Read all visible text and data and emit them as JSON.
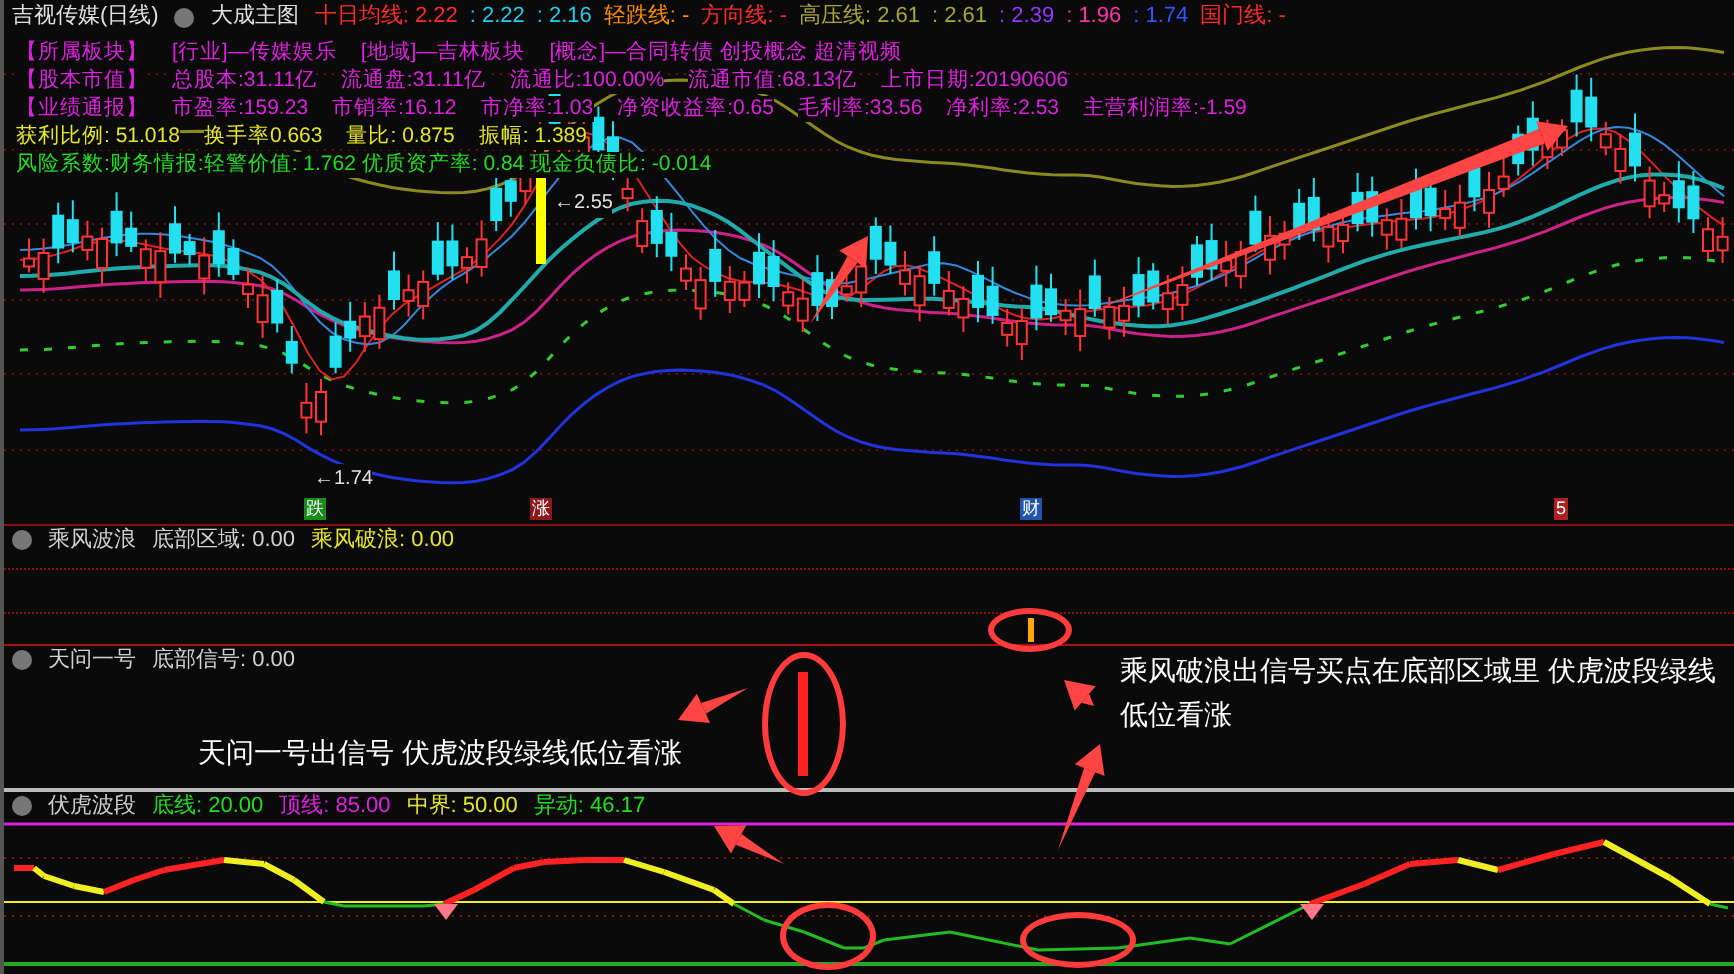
{
  "header": {
    "title": "吉视传媒(日线)",
    "indicator": "大成主图",
    "values": [
      {
        "text": "十日均线: 2.22",
        "color": "#ff2a2a"
      },
      {
        "text": ": 2.22",
        "color": "#22ccee"
      },
      {
        "text": ": 2.16",
        "color": "#22ccee"
      },
      {
        "text": "轻跌线: -",
        "color": "#ff8c00"
      },
      {
        "text": "方向线: -",
        "color": "#ff2a2a"
      },
      {
        "text": "高压线: 2.61",
        "color": "#a6a63a"
      },
      {
        "text": ": 2.61",
        "color": "#a6a63a"
      },
      {
        "text": ": 2.39",
        "color": "#9933ff"
      },
      {
        "text": ": 1.96",
        "color": "#ff33aa"
      },
      {
        "text": ": 1.74",
        "color": "#3355ff"
      },
      {
        "text": "国门线: -",
        "color": "#ff2a2a"
      }
    ]
  },
  "info_rows": [
    {
      "color": "#e020e0",
      "items": [
        "【所属板块】",
        "[行业]—传媒娱乐",
        "[地域]—吉林板块",
        "[概念]—合同转债 创投概念 超清视频"
      ]
    },
    {
      "color": "#e020e0",
      "items": [
        "【股本市值】",
        "总股本:31.11亿",
        "流通盘:31.11亿",
        "流通比:100.00%",
        "流通市值:68.13亿",
        "上市日期:20190606"
      ]
    },
    {
      "color": "#e020e0",
      "items": [
        "【业绩通报】",
        "市盈率:159.23",
        "市销率:16.12",
        "市净率:1.03",
        "净资收益率:0.65",
        "毛利率:33.56",
        "净利率:2.53",
        "主营利润率:-1.59"
      ]
    },
    {
      "color": "#e6e62a",
      "items": [
        "获利比例:  51.018",
        "换手率0.663",
        "量比:  0.875",
        "振幅:  1.389"
      ]
    },
    {
      "color": "#22dd22",
      "items": [
        "风险系数:财务情报:轻警价值: 1.762 优质资产率: 0.84 现金负债比: -0.014"
      ]
    }
  ],
  "price_labels": [
    "←2.55",
    "←1.74"
  ],
  "markers": [
    {
      "text": "跌",
      "color": "#1a8a1a"
    },
    {
      "text": "涨",
      "color": "#8a1a1a"
    },
    {
      "text": "财",
      "color": "#2255aa"
    },
    {
      "text": "5",
      "color": "#aa2222"
    }
  ],
  "panels": [
    {
      "title": "乘风波浪",
      "values": [
        {
          "text": "底部区域: 0.00",
          "color": "#d0d0d0"
        },
        {
          "text": "乘风破浪: 0.00",
          "color": "#e6e62a"
        }
      ]
    },
    {
      "title": "天问一号",
      "values": [
        {
          "text": "底部信号: 0.00",
          "color": "#d0d0d0"
        }
      ]
    },
    {
      "title": "伏虎波段",
      "values": [
        {
          "text": "底线: 20.00",
          "color": "#22dd22"
        },
        {
          "text": "顶线: 85.00",
          "color": "#e020e0"
        },
        {
          "text": "中界: 50.00",
          "color": "#e6e62a"
        },
        {
          "text": "异动: 46.17",
          "color": "#22dd22"
        }
      ]
    }
  ],
  "annotations": [
    "天问一号出信号 伏虎波段绿线低位看涨",
    "乘风破浪出信号买点在底部区域里 伏虎波段绿线低位看涨"
  ]
}
